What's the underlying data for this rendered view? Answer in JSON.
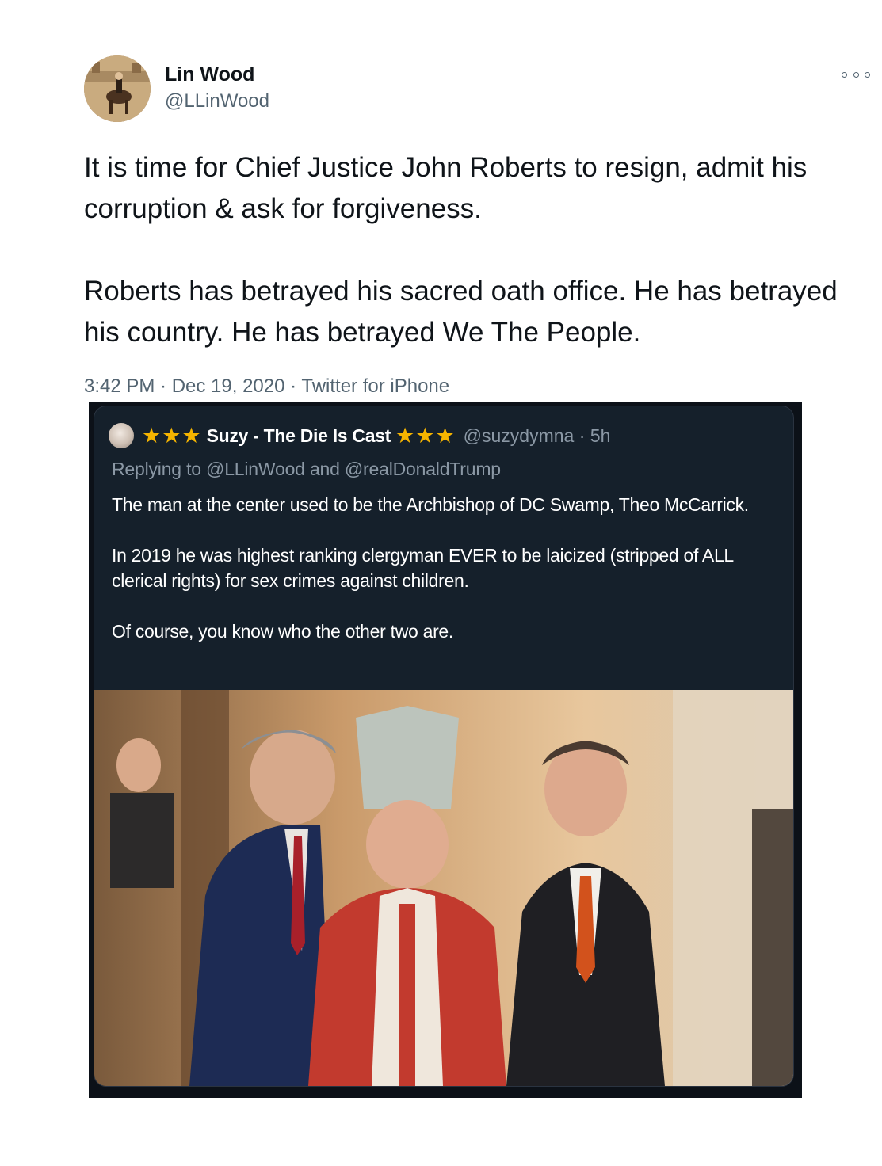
{
  "tweet": {
    "author_name": "Lin Wood",
    "author_handle": "@LLinWood",
    "more_icon": "more-icon",
    "text_paragraphs": [
      "It is time for Chief Justice John Roberts to resign, admit his corruption & ask for forgiveness.",
      "Roberts has betrayed his sacred oath office. He has betrayed his country. He has betrayed We The People."
    ],
    "timestamp": "3:42 PM · Dec 19, 2020 · Twitter for iPhone"
  },
  "embedded": {
    "stars_left": "★★★",
    "display_name": "Suzy - The Die Is Cast",
    "stars_right": "★★★",
    "handle_time": "@suzydymna · 5h",
    "replying_to": "Replying to @LLinWood and @realDonaldTrump",
    "body_paragraphs": [
      "The man at the center used to be the Archbishop of DC Swamp, Theo McCarrick.",
      "In 2019 he was highest ranking clergyman EVER to be laicized (stripped of ALL clerical rights) for sex crimes against children.",
      "Of course, you know who the other two are."
    ],
    "star_color": "#f5b400"
  },
  "colors": {
    "text_primary": "#0f1419",
    "text_secondary": "#536471",
    "dark_bg": "#15202b"
  }
}
